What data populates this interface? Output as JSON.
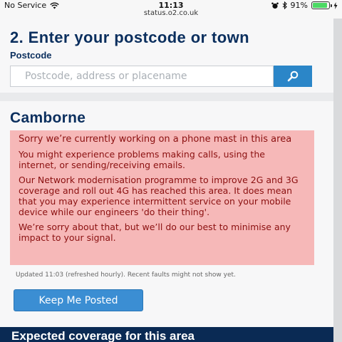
{
  "status_bar": {
    "carrier": "No Service",
    "time": "11:13",
    "url": "status.o2.co.uk",
    "battery_percent": "91%",
    "battery_level": 0.91
  },
  "search": {
    "title": "2. Enter your postcode or town",
    "label": "Postcode",
    "placeholder": "Postcode, address or placename",
    "button_icon": "search-icon"
  },
  "area": {
    "name": "Camborne",
    "alert": {
      "heading": "Sorry we’re currently working on a phone mast in this area",
      "paragraphs": [
        "You might experience problems making calls, using the internet, or sending/receiving emails.",
        "Our Network modernisation programme to improve 2G and 3G coverage and roll out 4G has reached this area. It does mean that you may experience intermittent service on your mobile device while our engineers 'do their thing'.",
        "We’re sorry about that, but we’ll do our best to minimise any impact to your signal."
      ]
    },
    "updated_note": "Updated 11:03 (refreshed hourly). Recent faults might not show yet.",
    "keep_button_label": "Keep Me Posted"
  },
  "coverage": {
    "title": "Expected coverage for this area"
  },
  "colors": {
    "brand_navy": "#0b2f5e",
    "accent_blue": "#2b86c8",
    "alert_bg": "#f6b8b8",
    "alert_text": "#8b1010"
  }
}
